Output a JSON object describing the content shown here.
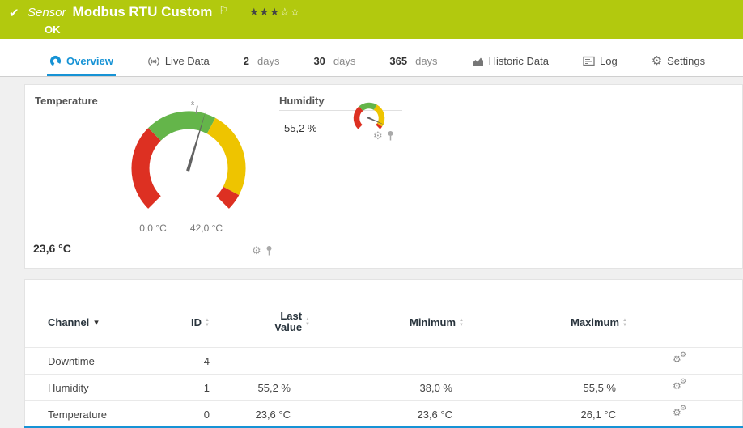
{
  "colors": {
    "header-green": "#b2c90e",
    "accent-blue": "#1793d5",
    "gauge-red": "#dd3022",
    "gauge-green": "#64b54a",
    "gauge-yellow": "#eec400",
    "needle-gray": "#636363"
  },
  "header": {
    "kind_label": "Sensor",
    "title": "Modbus RTU Custom",
    "status": "OK",
    "stars_filled": "★★★",
    "stars_empty": "☆☆"
  },
  "tabs": [
    {
      "label": "Overview"
    },
    {
      "label": "Live Data"
    },
    {
      "num": "2",
      "unit": "days"
    },
    {
      "num": "30",
      "unit": "days"
    },
    {
      "num": "365",
      "unit": "days"
    },
    {
      "label": "Historic Data"
    },
    {
      "label": "Log"
    },
    {
      "label": "Settings"
    }
  ],
  "gauges": {
    "temperature": {
      "label": "Temperature",
      "value": 23.6,
      "min": 0,
      "max": 42,
      "value_text": "23,6 °C",
      "min_label": "0,0 °C",
      "max_label": "42,0 °C",
      "avg_marker": "x̄"
    },
    "humidity": {
      "label": "Humidity",
      "value": 55.2,
      "value_text": "55,2 %",
      "needle_fraction": 0.92
    }
  },
  "table": {
    "headers": {
      "channel": "Channel",
      "id": "ID",
      "last_line1": "Last",
      "last_line2": "Value",
      "minimum": "Minimum",
      "maximum": "Maximum"
    },
    "rows": [
      {
        "channel": "Downtime",
        "id": "-4",
        "last": "",
        "min": "",
        "max": ""
      },
      {
        "channel": "Humidity",
        "id": "1",
        "last": "55,2 %",
        "min": "38,0 %",
        "max": "55,5 %"
      },
      {
        "channel": "Temperature",
        "id": "0",
        "last": "23,6 °C",
        "min": "23,6 °C",
        "max": "26,1 °C"
      }
    ]
  }
}
